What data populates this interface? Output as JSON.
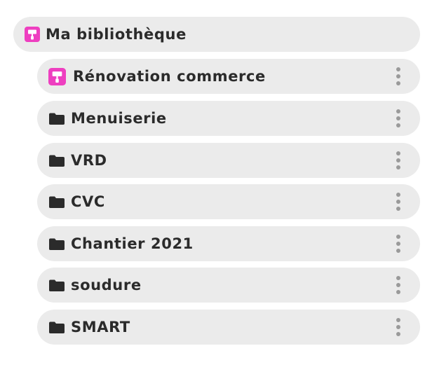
{
  "accent_color": "#ee3fc0",
  "root": {
    "label": "Ma bibliothèque",
    "icon": "paint-roller-icon"
  },
  "items": [
    {
      "label": "Rénovation commerce",
      "icon": "paint-roller-icon"
    },
    {
      "label": "Menuiserie",
      "icon": "folder-icon"
    },
    {
      "label": "VRD",
      "icon": "folder-icon"
    },
    {
      "label": "CVC",
      "icon": "folder-icon"
    },
    {
      "label": "Chantier 2021",
      "icon": "folder-icon"
    },
    {
      "label": "soudure",
      "icon": "folder-icon"
    },
    {
      "label": "SMART",
      "icon": "folder-icon"
    }
  ],
  "more_menu_icon": "vertical-dots-icon"
}
